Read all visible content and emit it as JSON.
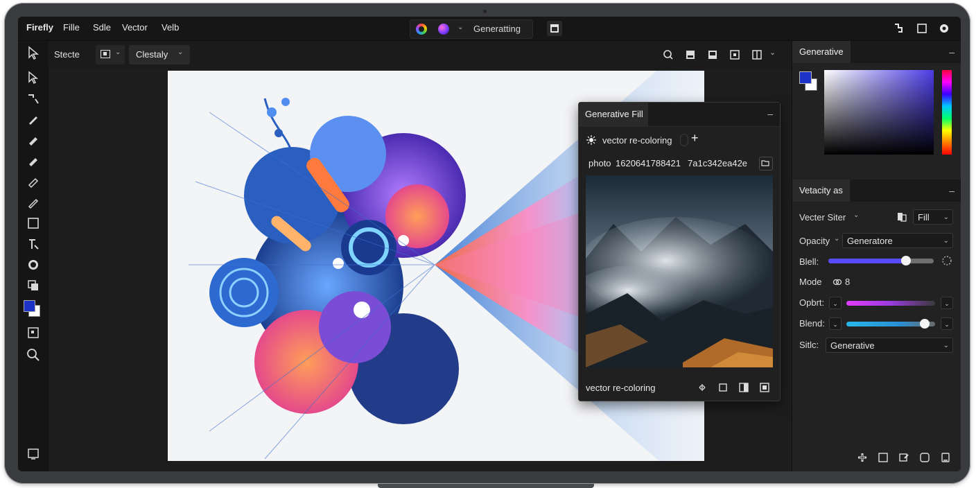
{
  "menubar": {
    "items": [
      "Firefly",
      "Fille",
      "Sdle",
      "Vector",
      "Velb"
    ],
    "status_label": "Generatting"
  },
  "options_bar": {
    "select_label": "Stecte",
    "mode_value": "Clestaly"
  },
  "generative_fill": {
    "title": "Generative Fill",
    "prompt_text": "vector re-coloring",
    "photo_name": "photo",
    "photo_id": "1620641788421",
    "photo_hash": "7a1c342ea42e",
    "footer_text": "vector re-coloring"
  },
  "right_panel": {
    "color_tab": "Generative",
    "props_tab": "Vetacity as",
    "vector_filter_label": "Vecter Siter",
    "fill_value": "Fill",
    "opacity_label": "Opacity",
    "opacity_value": "Generatore",
    "blell_label": "Blell:",
    "blell_value": 0.74,
    "mode_label": "Mode",
    "mode_value": "8",
    "opbrt_label": "Opbrt:",
    "blend_label": "Blend:",
    "blend_value": 0.88,
    "style_label": "Sitlc:",
    "style_value": "Generative"
  },
  "colors": {
    "accent": "#5b4bff",
    "foreground_swatch": "#1d33c8",
    "panel_bg": "#222222"
  },
  "icons": [
    "selection-arrow-icon",
    "direct-select-icon",
    "pen-icon",
    "brush-icon",
    "eraser-icon",
    "rectangle-icon",
    "type-icon",
    "ellipse-icon",
    "layers-icon",
    "zoom-icon",
    "generate-sparkle-icon",
    "plus-icon"
  ]
}
